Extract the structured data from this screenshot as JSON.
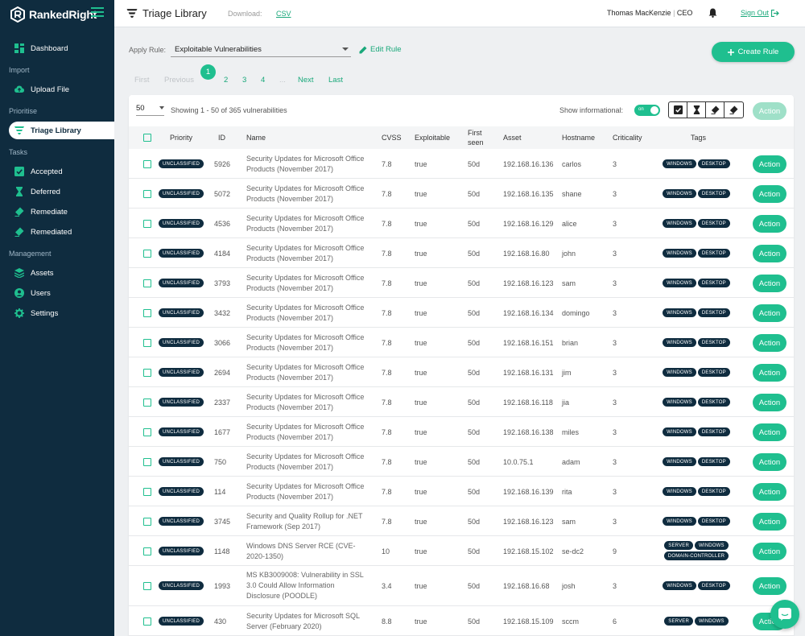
{
  "app": {
    "name": "RankedRight"
  },
  "sidebar": {
    "sections": [
      {
        "label": "Import",
        "items": [
          {
            "label": "Upload File",
            "icon": "cloud-upload-icon"
          }
        ]
      },
      {
        "label": "Prioritise",
        "items": [
          {
            "label": "Triage Library",
            "icon": "triage-filter-icon",
            "active": true
          }
        ]
      },
      {
        "label": "Tasks",
        "items": [
          {
            "label": "Accepted",
            "icon": "check-icon"
          },
          {
            "label": "Deferred",
            "icon": "hourglass-icon"
          },
          {
            "label": "Remediate",
            "icon": "eraser-icon"
          },
          {
            "label": "Remediated",
            "icon": "eraser-icon"
          }
        ]
      },
      {
        "label": "Management",
        "items": [
          {
            "label": "Assets",
            "icon": "layers-icon"
          },
          {
            "label": "Users",
            "icon": "user-icon"
          },
          {
            "label": "Settings",
            "icon": "gear-icon"
          }
        ]
      }
    ],
    "dashboard": {
      "label": "Dashboard",
      "icon": "dashboard-icon"
    }
  },
  "header": {
    "title": "Triage Library",
    "download_label": "Download:",
    "csv_label": "CSV",
    "user_name": "Thomas MacKenzie",
    "user_sep": "|",
    "user_role": "CEO",
    "sign_out": "Sign Out"
  },
  "controls": {
    "apply_rule_label": "Apply Rule:",
    "rule_value": "Exploitable Vulnerabilities",
    "edit_rule": "Edit Rule",
    "create_rule": "Create Rule"
  },
  "pagination": {
    "first": "First",
    "previous": "Previous",
    "pages": [
      "1",
      "2",
      "3",
      "4"
    ],
    "ellipsis": "...",
    "current": "1",
    "next": "Next",
    "last": "Last"
  },
  "table": {
    "per_page": "50",
    "showing": "Showing 1 - 50 of 365 vulnerabilities",
    "show_info_label": "Show informational:",
    "toggle_label": "on",
    "action_label": "Action",
    "columns": {
      "priority": "Priority",
      "id": "ID",
      "name": "Name",
      "cvss": "CVSS",
      "exploitable": "Exploitable",
      "first_seen_1": "First",
      "first_seen_2": "seen",
      "asset": "Asset",
      "hostname": "Hostname",
      "criticality": "Criticality",
      "tags": "Tags"
    },
    "rows": [
      {
        "priority": "UNCLASSIFIED",
        "id": "5926",
        "name": "Security Updates for Microsoft Office Products (November 2017)",
        "cvss": "7.8",
        "exploitable": "true",
        "first_seen": "50d",
        "asset": "192.168.16.136",
        "hostname": "carlos",
        "criticality": "3",
        "tags": [
          "WINDOWS",
          "DESKTOP"
        ]
      },
      {
        "priority": "UNCLASSIFIED",
        "id": "5072",
        "name": "Security Updates for Microsoft Office Products (November 2017)",
        "cvss": "7.8",
        "exploitable": "true",
        "first_seen": "50d",
        "asset": "192.168.16.135",
        "hostname": "shane",
        "criticality": "3",
        "tags": [
          "WINDOWS",
          "DESKTOP"
        ]
      },
      {
        "priority": "UNCLASSIFIED",
        "id": "4536",
        "name": "Security Updates for Microsoft Office Products (November 2017)",
        "cvss": "7.8",
        "exploitable": "true",
        "first_seen": "50d",
        "asset": "192.168.16.129",
        "hostname": "alice",
        "criticality": "3",
        "tags": [
          "WINDOWS",
          "DESKTOP"
        ]
      },
      {
        "priority": "UNCLASSIFIED",
        "id": "4184",
        "name": "Security Updates for Microsoft Office Products (November 2017)",
        "cvss": "7.8",
        "exploitable": "true",
        "first_seen": "50d",
        "asset": "192.168.16.80",
        "hostname": "john",
        "criticality": "3",
        "tags": [
          "WINDOWS",
          "DESKTOP"
        ]
      },
      {
        "priority": "UNCLASSIFIED",
        "id": "3793",
        "name": "Security Updates for Microsoft Office Products (November 2017)",
        "cvss": "7.8",
        "exploitable": "true",
        "first_seen": "50d",
        "asset": "192.168.16.123",
        "hostname": "sam",
        "criticality": "3",
        "tags": [
          "WINDOWS",
          "DESKTOP"
        ]
      },
      {
        "priority": "UNCLASSIFIED",
        "id": "3432",
        "name": "Security Updates for Microsoft Office Products (November 2017)",
        "cvss": "7.8",
        "exploitable": "true",
        "first_seen": "50d",
        "asset": "192.168.16.134",
        "hostname": "domingo",
        "criticality": "3",
        "tags": [
          "WINDOWS",
          "DESKTOP"
        ]
      },
      {
        "priority": "UNCLASSIFIED",
        "id": "3066",
        "name": "Security Updates for Microsoft Office Products (November 2017)",
        "cvss": "7.8",
        "exploitable": "true",
        "first_seen": "50d",
        "asset": "192.168.16.151",
        "hostname": "brian",
        "criticality": "3",
        "tags": [
          "WINDOWS",
          "DESKTOP"
        ]
      },
      {
        "priority": "UNCLASSIFIED",
        "id": "2694",
        "name": "Security Updates for Microsoft Office Products (November 2017)",
        "cvss": "7.8",
        "exploitable": "true",
        "first_seen": "50d",
        "asset": "192.168.16.131",
        "hostname": "jim",
        "criticality": "3",
        "tags": [
          "WINDOWS",
          "DESKTOP"
        ]
      },
      {
        "priority": "UNCLASSIFIED",
        "id": "2337",
        "name": "Security Updates for Microsoft Office Products (November 2017)",
        "cvss": "7.8",
        "exploitable": "true",
        "first_seen": "50d",
        "asset": "192.168.16.118",
        "hostname": "jia",
        "criticality": "3",
        "tags": [
          "WINDOWS",
          "DESKTOP"
        ]
      },
      {
        "priority": "UNCLASSIFIED",
        "id": "1677",
        "name": "Security Updates for Microsoft Office Products (November 2017)",
        "cvss": "7.8",
        "exploitable": "true",
        "first_seen": "50d",
        "asset": "192.168.16.138",
        "hostname": "miles",
        "criticality": "3",
        "tags": [
          "WINDOWS",
          "DESKTOP"
        ]
      },
      {
        "priority": "UNCLASSIFIED",
        "id": "750",
        "name": "Security Updates for Microsoft Office Products (November 2017)",
        "cvss": "7.8",
        "exploitable": "true",
        "first_seen": "50d",
        "asset": "10.0.75.1",
        "hostname": "adam",
        "criticality": "3",
        "tags": [
          "WINDOWS",
          "DESKTOP"
        ]
      },
      {
        "priority": "UNCLASSIFIED",
        "id": "114",
        "name": "Security Updates for Microsoft Office Products (November 2017)",
        "cvss": "7.8",
        "exploitable": "true",
        "first_seen": "50d",
        "asset": "192.168.16.139",
        "hostname": "rita",
        "criticality": "3",
        "tags": [
          "WINDOWS",
          "DESKTOP"
        ]
      },
      {
        "priority": "UNCLASSIFIED",
        "id": "3745",
        "name": "Security and Quality Rollup for .NET Framework (Sep 2017)",
        "cvss": "7.8",
        "exploitable": "true",
        "first_seen": "50d",
        "asset": "192.168.16.123",
        "hostname": "sam",
        "criticality": "3",
        "tags": [
          "WINDOWS",
          "DESKTOP"
        ]
      },
      {
        "priority": "UNCLASSIFIED",
        "id": "1148",
        "name": "Windows DNS Server RCE (CVE-2020-1350)",
        "cvss": "10",
        "exploitable": "true",
        "first_seen": "50d",
        "asset": "192.168.15.102",
        "hostname": "se-dc2",
        "criticality": "9",
        "tags": [
          "SERVER",
          "WINDOWS",
          "DOMAIN-CONTROLLER"
        ]
      },
      {
        "priority": "UNCLASSIFIED",
        "id": "1993",
        "name": "MS KB3009008: Vulnerability in SSL 3.0 Could Allow Information Disclosure (POODLE)",
        "cvss": "3.4",
        "exploitable": "true",
        "first_seen": "50d",
        "asset": "192.168.16.68",
        "hostname": "josh",
        "criticality": "3",
        "tags": [
          "WINDOWS",
          "DESKTOP"
        ]
      },
      {
        "priority": "UNCLASSIFIED",
        "id": "430",
        "name": "Security Updates for Microsoft SQL Server (February 2020)",
        "cvss": "8.8",
        "exploitable": "true",
        "first_seen": "50d",
        "asset": "192.168.15.109",
        "hostname": "sccm",
        "criticality": "6",
        "tags": [
          "SERVER",
          "WINDOWS"
        ]
      }
    ]
  },
  "colors": {
    "accent": "#1fbf8f",
    "sidebar": "#0f2c3f",
    "badge": "#0f2c3f"
  }
}
